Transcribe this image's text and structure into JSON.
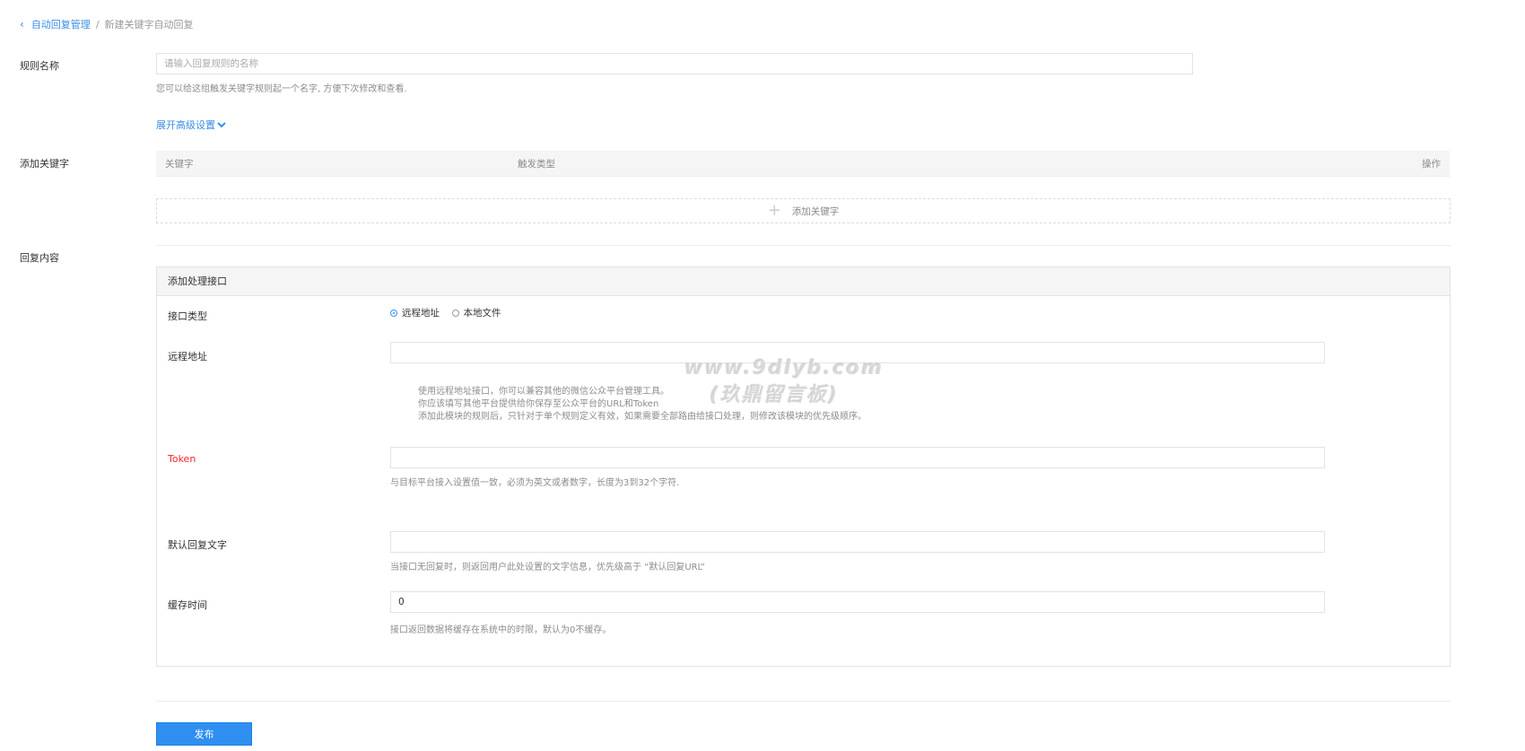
{
  "breadcrumb": {
    "parent": "自动回复管理",
    "separator": "/",
    "current": "新建关键字自动回复"
  },
  "rule_name": {
    "label": "规则名称",
    "placeholder": "请输入回复规则的名称",
    "help": "您可以给这组触发关键字规则起一个名字, 方便下次修改和查看."
  },
  "advanced_toggle": {
    "label": "展开高级设置"
  },
  "keywords": {
    "label": "添加关键字",
    "columns": [
      "关键字",
      "触发类型",
      "操作"
    ],
    "add_label": "添加关键字"
  },
  "reply": {
    "label": "回复内容",
    "panel_title": "添加处理接口",
    "interface_type": {
      "label": "接口类型",
      "options": [
        "远程地址",
        "本地文件"
      ],
      "selected": "远程地址"
    },
    "remote_url": {
      "label": "远程地址",
      "value": "",
      "help_lines": [
        "使用远程地址接口，你可以兼容其他的微信公众平台管理工具。",
        "你应该填写其他平台提供给你保存至公众平台的URL和Token",
        "添加此模块的规则后，只针对于单个规则定义有效，如果需要全部路由给接口处理，则修改该模块的优先级顺序。"
      ]
    },
    "token": {
      "label": "Token",
      "value": "",
      "help": "与目标平台接入设置值一致，必须为英文或者数字，长度为3到32个字符.",
      "label_color": "#f5222d"
    },
    "default_reply": {
      "label": "默认回复文字",
      "value": "",
      "help": "当接口无回复时，则返回用户此处设置的文字信息，优先级高于 “默认回复URL”"
    },
    "cache_time": {
      "label": "缓存时间",
      "value": "0",
      "help": "接口返回数据将缓存在系统中的时限，默认为0不缓存。"
    }
  },
  "watermark": {
    "line1": "www.9dlyb.com",
    "line2": "(玖鼎留言板)"
  },
  "submit": {
    "label": "发布"
  },
  "colors": {
    "accent": "#2f8ff0",
    "link": "#3a8ee6"
  }
}
